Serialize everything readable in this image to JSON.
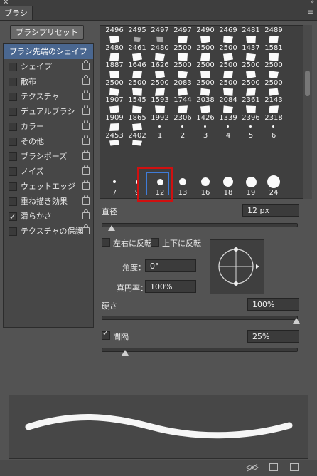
{
  "window": {
    "tab_title": "ブラシ",
    "close_glyph": "✕",
    "collapse_glyph": "»",
    "menu_glyph": "≡"
  },
  "preset_button": "ブラシプリセット",
  "sidebar": {
    "items": [
      {
        "label": "ブラシ先端のシェイプ",
        "selected": true
      },
      {
        "label": "シェイプ",
        "checked": false,
        "lock": true
      },
      {
        "label": "散布",
        "checked": false,
        "lock": true
      },
      {
        "label": "テクスチャ",
        "checked": false,
        "lock": true
      },
      {
        "label": "デュアルブラシ",
        "checked": false,
        "lock": true
      },
      {
        "label": "カラー",
        "checked": false,
        "lock": true
      },
      {
        "label": "その他",
        "checked": false,
        "lock": true
      },
      {
        "label": "ブラシポーズ",
        "checked": false,
        "lock": true
      },
      {
        "label": "ノイズ",
        "checked": false,
        "lock": true
      },
      {
        "label": "ウェットエッジ",
        "checked": false,
        "lock": true
      },
      {
        "label": "重ね描き効果",
        "checked": false,
        "lock": true
      },
      {
        "label": "滑らかさ",
        "checked": true,
        "lock": true
      },
      {
        "label": "テクスチャの保護",
        "checked": false,
        "lock": true
      }
    ]
  },
  "brush_grid": {
    "rows": [
      [
        "2496",
        "2495",
        "2497",
        "2497",
        "2490",
        "2469",
        "2481",
        "2489"
      ],
      [
        "2480",
        "2461",
        "2480",
        "2500",
        "2500",
        "2500",
        "1437",
        "1581"
      ],
      [
        "1887",
        "1646",
        "1626",
        "2500",
        "2500",
        "2500",
        "2500",
        "2500"
      ],
      [
        "2500",
        "2500",
        "2500",
        "2083",
        "2500",
        "2500",
        "2500",
        "2500"
      ],
      [
        "1907",
        "1545",
        "1593",
        "1744",
        "2038",
        "2084",
        "2361",
        "2143"
      ],
      [
        "1909",
        "1865",
        "1992",
        "2306",
        "1426",
        "1339",
        "2396",
        "2318"
      ],
      [
        "2453",
        "2402",
        "1",
        "2",
        "3",
        "4",
        "5",
        "6"
      ]
    ],
    "round_row": [
      "7",
      "9",
      "12",
      "13",
      "16",
      "18",
      "19",
      "24"
    ],
    "selected_size": "12"
  },
  "controls": {
    "diameter_label": "直径",
    "diameter_value": "12 px",
    "diameter_slider": 0.05,
    "flip_x_label": "左右に反転",
    "flip_y_label": "上下に反転",
    "angle_label": "角度：",
    "angle_value": "0°",
    "roundness_label": "真円率：",
    "roundness_value": "100%",
    "hardness_label": "硬さ",
    "hardness_value": "100%",
    "hardness_slider": 1.0,
    "spacing_label": "間隔",
    "spacing_checked": true,
    "spacing_value": "25%",
    "spacing_slider": 0.12
  },
  "icons": {
    "bottom": [
      "preview-eye-icon",
      "grid-toggle-icon",
      "new-preset-icon"
    ]
  }
}
